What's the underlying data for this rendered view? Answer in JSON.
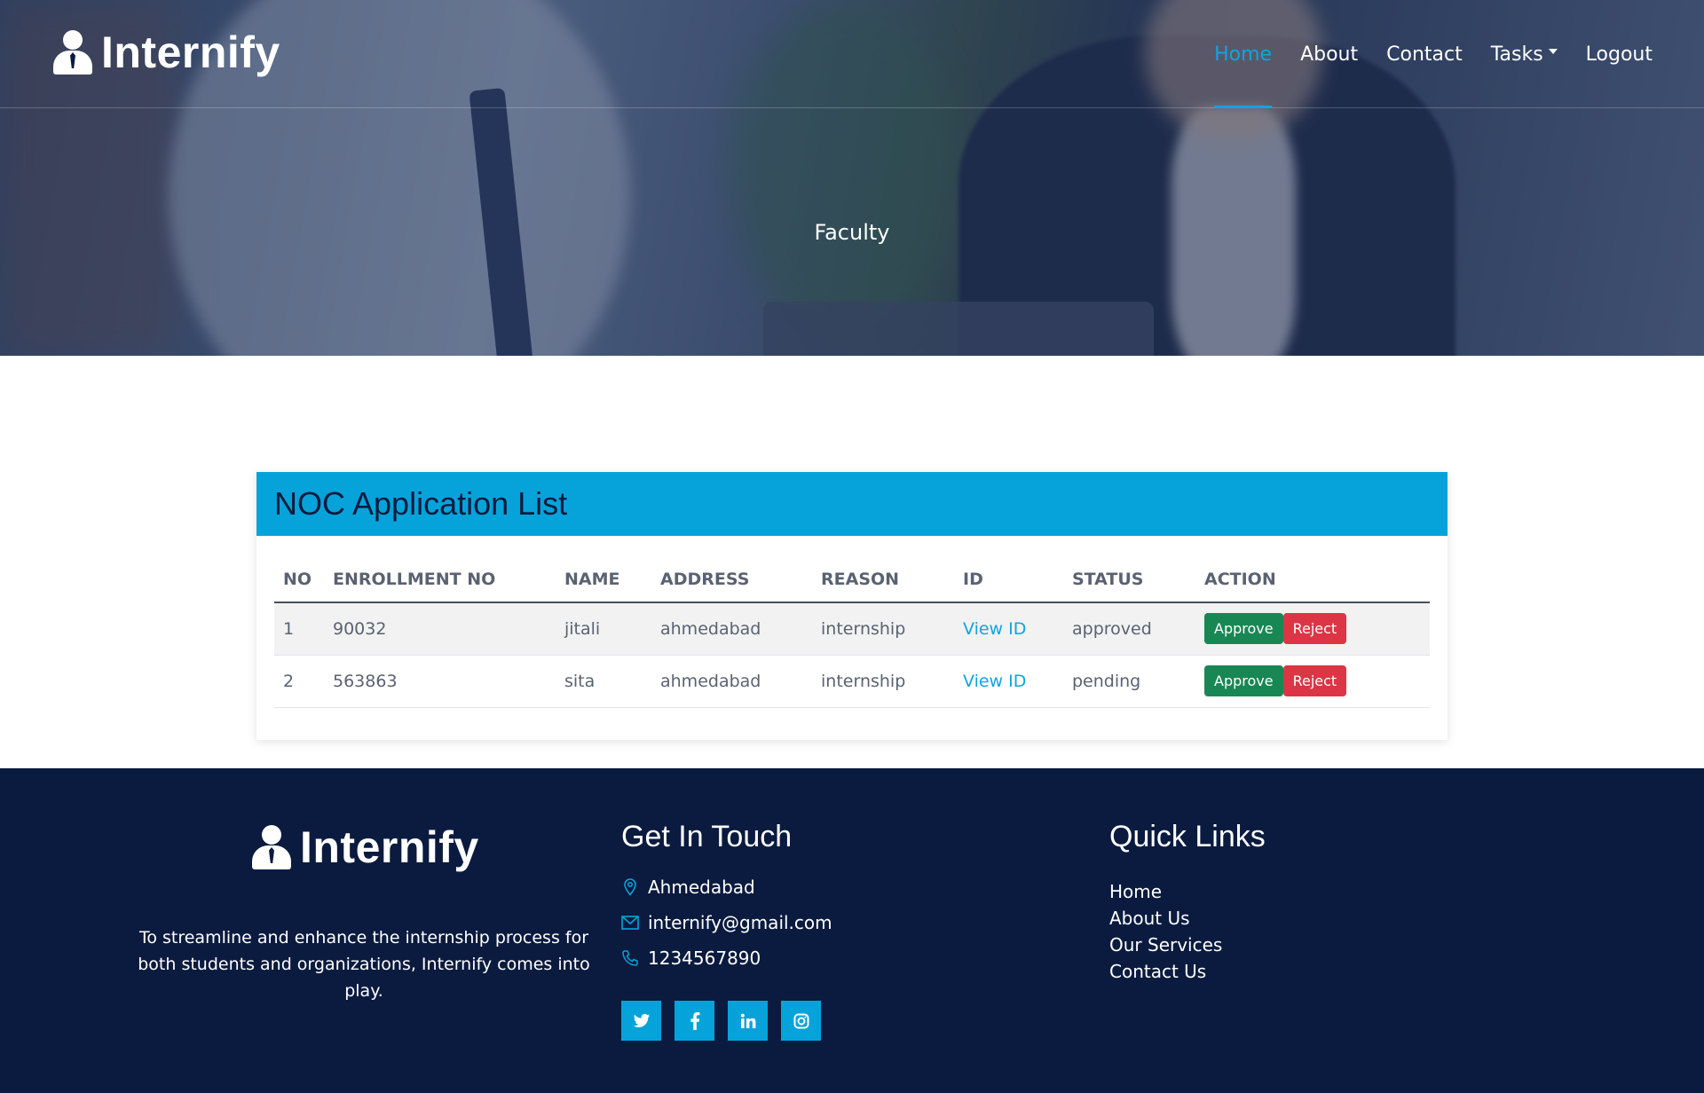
{
  "brand": {
    "name": "Internify"
  },
  "nav": {
    "items": [
      {
        "label": "Home",
        "active": true
      },
      {
        "label": "About"
      },
      {
        "label": "Contact"
      },
      {
        "label": "Tasks",
        "dropdown": true
      },
      {
        "label": "Logout"
      }
    ]
  },
  "hero": {
    "title": "Faculty"
  },
  "card": {
    "title": "NOC Application List",
    "columns": [
      "NO",
      "ENROLLMENT NO",
      "NAME",
      "ADDRESS",
      "REASON",
      "ID",
      "STATUS",
      "ACTION"
    ],
    "rows": [
      {
        "no": "1",
        "enrollment": "90032",
        "name": "jitali",
        "address": "ahmedabad",
        "reason": "internship",
        "id_link": "View ID",
        "status": "approved",
        "approve": "Approve",
        "reject": "Reject"
      },
      {
        "no": "2",
        "enrollment": "563863",
        "name": "sita",
        "address": "ahmedabad",
        "reason": "internship",
        "id_link": "View ID",
        "status": "pending",
        "approve": "Approve",
        "reject": "Reject"
      }
    ]
  },
  "footer": {
    "brand": "Internify",
    "description": "To streamline and enhance the internship process for both students and organizations, Internify comes into play.",
    "contact": {
      "title": "Get In Touch",
      "address": "Ahmedabad",
      "email": "internify@gmail.com",
      "phone": "1234567890"
    },
    "social": [
      "twitter-icon",
      "facebook-icon",
      "linkedin-icon",
      "instagram-icon"
    ],
    "quick_links": {
      "title": "Quick Links",
      "items": [
        "Home",
        "About Us",
        "Our Services",
        "Contact Us"
      ]
    }
  },
  "colors": {
    "accent": "#06a3da",
    "footer_bg": "#0b1b3f",
    "approve": "#198754",
    "reject": "#dc3545"
  }
}
